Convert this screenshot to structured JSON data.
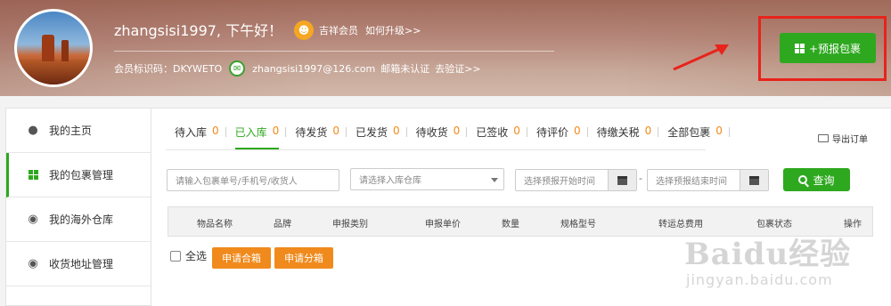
{
  "header": {
    "greeting": "zhangsisi1997, 下午好！",
    "vip_level": "吉祥会员",
    "vip_upgrade": "如何升级>>",
    "member_id": "会员标识码：DKYWETO",
    "email": "zhangsisi1997@126.com",
    "email_status": "邮箱未认证",
    "verify_link": "去验证>>",
    "predict_button": "+预报包裹"
  },
  "sidebar": {
    "items": [
      {
        "label": "我的主页",
        "icon": "user-icon"
      },
      {
        "label": "我的包裹管理",
        "icon": "grid-icon"
      },
      {
        "label": "我的海外仓库",
        "icon": "globe-icon"
      },
      {
        "label": "收货地址管理",
        "icon": "map-pin-icon"
      }
    ]
  },
  "tabs": [
    {
      "label": "待入库",
      "count": "0"
    },
    {
      "label": "已入库",
      "count": "0"
    },
    {
      "label": "待发货",
      "count": "0"
    },
    {
      "label": "已发货",
      "count": "0"
    },
    {
      "label": "待收货",
      "count": "0"
    },
    {
      "label": "已签收",
      "count": "0"
    },
    {
      "label": "待评价",
      "count": "0"
    },
    {
      "label": "待缴关税",
      "count": "0"
    },
    {
      "label": "全部包裹",
      "count": "0"
    }
  ],
  "export_label": "导出订单",
  "filters": {
    "search_placeholder": "请输入包裹单号/手机号/收货人",
    "warehouse_placeholder": "请选择入库仓库",
    "start_placeholder": "选择预报开始时间",
    "end_placeholder": "选择预报结束时间",
    "range_separator": "-",
    "query_label": "查询"
  },
  "table": {
    "columns": [
      "物品名称",
      "品牌",
      "申报类别",
      "申报单价",
      "数量",
      "规格型号",
      "转运总费用",
      "包裹状态",
      "操作"
    ]
  },
  "actions": {
    "select_all": "全选",
    "merge": "申请合箱",
    "split": "申请分箱"
  },
  "watermark": {
    "logo": "Baidu经验",
    "url": "jingyan.baidu.com"
  },
  "colors": {
    "accent_green": "#2ea81f",
    "accent_orange": "#f08a1c",
    "highlight_red": "#e8231c"
  }
}
